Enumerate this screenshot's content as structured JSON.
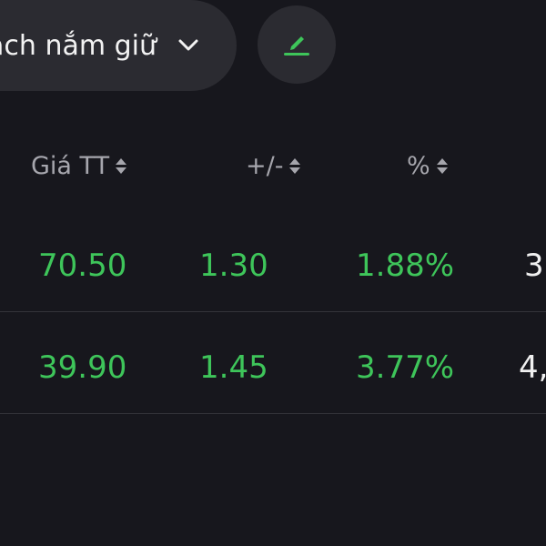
{
  "header": {
    "list_selector_label": "ách nắm giữ",
    "icons": {
      "chevron": "chevron-down-icon",
      "edit": "pencil-edit-icon"
    },
    "accent_color": "#3ec55a"
  },
  "table": {
    "columns": [
      {
        "label": "Giá TT",
        "sort_icon": "sort-icon"
      },
      {
        "label": "+/-",
        "sort_icon": "sort-icon"
      },
      {
        "label": "%",
        "sort_icon": "sort-icon"
      }
    ],
    "rows": [
      {
        "price": "70.50",
        "change": "1.30",
        "percent": "1.88%",
        "extra": "3"
      },
      {
        "price": "39.90",
        "change": "1.45",
        "percent": "3.77%",
        "extra": "4,"
      }
    ],
    "colors": {
      "positive": "#3ec55a",
      "header_text": "#a6a6ad",
      "background": "#17171d"
    }
  }
}
